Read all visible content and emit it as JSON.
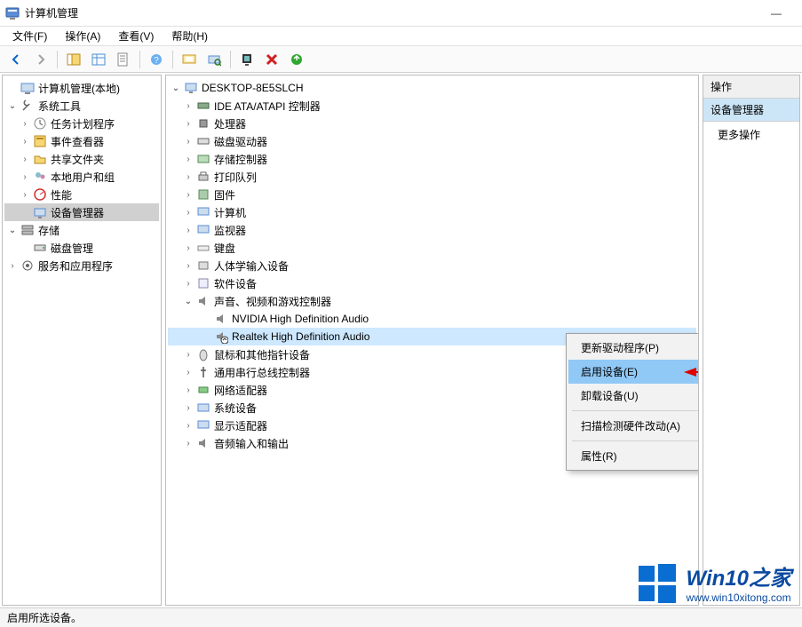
{
  "window": {
    "title": "计算机管理",
    "minimize": "—"
  },
  "menubar": {
    "file": "文件(F)",
    "action": "操作(A)",
    "view": "查看(V)",
    "help": "帮助(H)"
  },
  "statusbar": {
    "text": "启用所选设备。"
  },
  "left_tree": {
    "root": "计算机管理(本地)",
    "system_tools": "系统工具",
    "task_scheduler": "任务计划程序",
    "event_viewer": "事件查看器",
    "shared_folders": "共享文件夹",
    "local_users": "本地用户和组",
    "performance": "性能",
    "device_manager": "设备管理器",
    "storage": "存储",
    "disk_mgmt": "磁盘管理",
    "services": "服务和应用程序"
  },
  "mid_tree": {
    "root": "DESKTOP-8E5SLCH",
    "ide": "IDE ATA/ATAPI 控制器",
    "cpu": "处理器",
    "disk_drives": "磁盘驱动器",
    "storage_ctrl": "存储控制器",
    "print_queues": "打印队列",
    "firmware": "固件",
    "computer": "计算机",
    "monitors": "监视器",
    "keyboards": "键盘",
    "hid": "人体学输入设备",
    "software_dev": "软件设备",
    "sound": "声音、视频和游戏控制器",
    "nvidia_audio": "NVIDIA High Definition Audio",
    "realtek_audio": "Realtek High Definition Audio",
    "mouse": "鼠标和其他指针设备",
    "usb": "通用串行总线控制器",
    "network": "网络适配器",
    "system_devices": "系统设备",
    "display": "显示适配器",
    "audio_io": "音频输入和输出"
  },
  "context_menu": {
    "update_driver": "更新驱动程序(P)",
    "enable_device": "启用设备(E)",
    "uninstall": "卸载设备(U)",
    "scan": "扫描检测硬件改动(A)",
    "properties": "属性(R)"
  },
  "right_panel": {
    "header": "操作",
    "section": "设备管理器",
    "more": "更多操作"
  },
  "watermark": {
    "title": "Win10之家",
    "url": "www.win10xitong.com"
  }
}
